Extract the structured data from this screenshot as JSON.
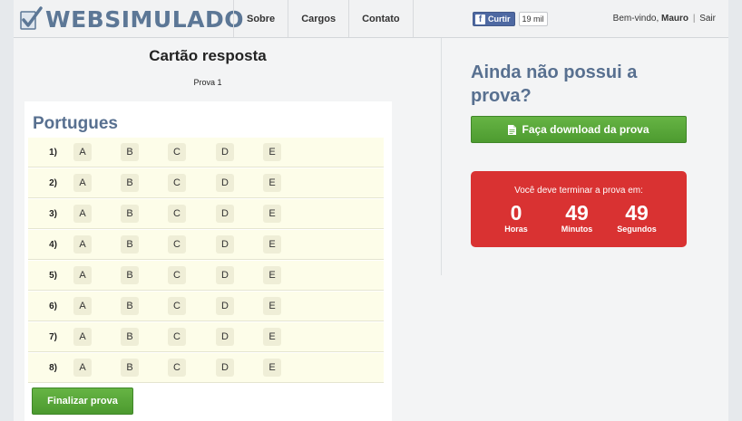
{
  "brand": {
    "logo_text": "WEBSIMULADO"
  },
  "nav": {
    "items": [
      {
        "id": "sobre",
        "label": "Sobre"
      },
      {
        "id": "cargos",
        "label": "Cargos"
      },
      {
        "id": "contato",
        "label": "Contato"
      }
    ]
  },
  "facebook": {
    "like_label": "Curtir",
    "count": "19 mil"
  },
  "user": {
    "greeting": "Bem-vindo,",
    "name": "Mauro",
    "separator": "|",
    "logout": "Sair"
  },
  "sheet": {
    "title": "Cartão resposta",
    "subtitle": "Prova 1",
    "section": "Portugues",
    "options": [
      "A",
      "B",
      "C",
      "D",
      "E"
    ],
    "questions": [
      "1)",
      "2)",
      "3)",
      "4)",
      "5)",
      "6)",
      "7)",
      "8)"
    ],
    "finish_label": "Finalizar prova"
  },
  "sidebar": {
    "heading": "Ainda não possui a prova?",
    "download_label": "Faça download da prova",
    "timer": {
      "message": "Você deve terminar a prova em:",
      "hours": "0",
      "hours_label": "Horas",
      "minutes": "49",
      "minutes_label": "Minutos",
      "seconds": "49",
      "seconds_label": "Segundos"
    }
  },
  "colors": {
    "brand": "#5c7796",
    "heading": "#587090",
    "button_green": "#5aa83b",
    "timer_red": "#d93232",
    "facebook": "#4e69a2"
  }
}
